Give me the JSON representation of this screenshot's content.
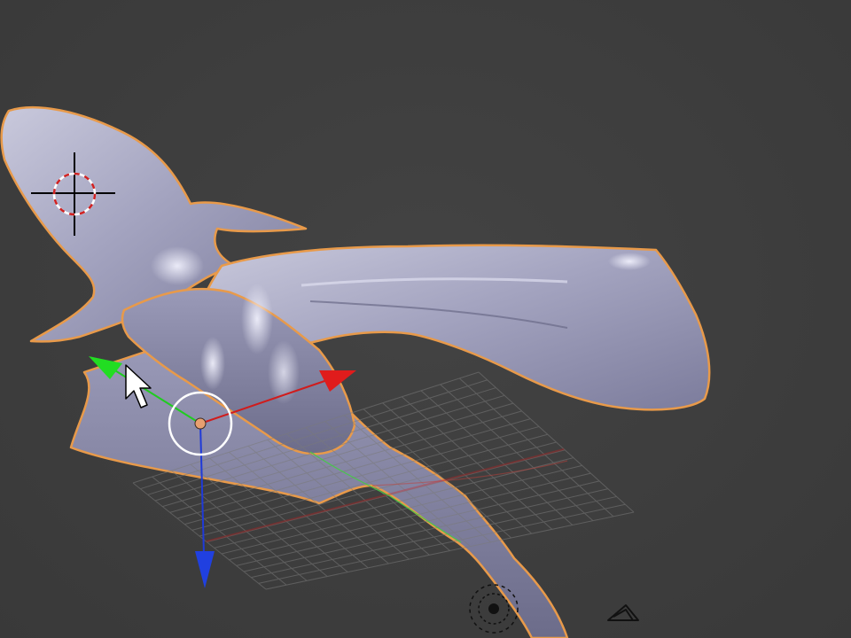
{
  "viewport": {
    "background_color": "#3d3d3d",
    "selection_outline_color": "#e89a4a",
    "mesh_color": "#a8a8c4",
    "grid_color": "#7a7a7a",
    "axis_x_color": "#d01c1c",
    "axis_y_color": "#1fcc1f",
    "axis_z_color": "#1f3ad8"
  },
  "objects": {
    "selected_mesh": "creature-mesh",
    "cursor": "3d-cursor-icon",
    "manipulator": "transform-manipulator",
    "lamp": "lamp-icon",
    "camera": "camera-icon",
    "mouse_pointer": "mouse-pointer-icon"
  }
}
